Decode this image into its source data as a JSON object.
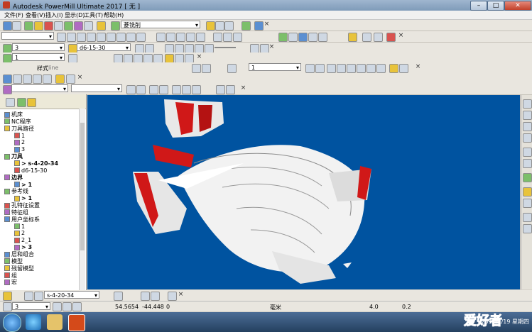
{
  "window": {
    "title": "Autodesk PowerMill Ultimate 2017   [ 无 ]",
    "min": "–",
    "max": "□",
    "close": "✕"
  },
  "menu": [
    "文件(F)",
    "查看(V)",
    "插入(I)",
    "显示(D)",
    "工具(T)",
    "帮助(H)"
  ],
  "toolbars": {
    "row1_combo": "菱铣削",
    "row3_combo_a": "3",
    "row3_combo_b": "d6-15-30",
    "row4_combo": "1",
    "row5_style_label": "样式",
    "row5_style_value": "line",
    "row5_combo_right": "1"
  },
  "explorer": {
    "items": [
      {
        "label": "机床",
        "indent": 0,
        "bold": false
      },
      {
        "label": "NC程序",
        "indent": 0,
        "bold": false
      },
      {
        "label": "刀具路径",
        "indent": 0,
        "bold": false
      },
      {
        "label": "1",
        "indent": 1,
        "bold": false
      },
      {
        "label": "2",
        "indent": 1,
        "bold": false
      },
      {
        "label": "3",
        "indent": 1,
        "bold": false
      },
      {
        "label": "刀具",
        "indent": 0,
        "bold": true
      },
      {
        "label": "> s-4-20-34",
        "indent": 1,
        "bold": true
      },
      {
        "label": "d6-15-30",
        "indent": 1,
        "bold": false
      },
      {
        "label": "边界",
        "indent": 0,
        "bold": true
      },
      {
        "label": "> 1",
        "indent": 1,
        "bold": true
      },
      {
        "label": "参考线",
        "indent": 0,
        "bold": false
      },
      {
        "label": "> 1",
        "indent": 1,
        "bold": true
      },
      {
        "label": "孔特征设置",
        "indent": 0,
        "bold": false
      },
      {
        "label": "特征组",
        "indent": 0,
        "bold": false
      },
      {
        "label": "用户坐标系",
        "indent": 0,
        "bold": false
      },
      {
        "label": "1",
        "indent": 1,
        "bold": false
      },
      {
        "label": "2",
        "indent": 1,
        "bold": false
      },
      {
        "label": "2_1",
        "indent": 1,
        "bold": false
      },
      {
        "label": "> 3",
        "indent": 1,
        "bold": true
      },
      {
        "label": "层和组合",
        "indent": 0,
        "bold": false
      },
      {
        "label": "模型",
        "indent": 0,
        "bold": false
      },
      {
        "label": "残留模型",
        "indent": 0,
        "bold": false
      },
      {
        "label": "组",
        "indent": 0,
        "bold": false
      },
      {
        "label": "宏",
        "indent": 0,
        "bold": false
      }
    ]
  },
  "bottom_toolbar": {
    "tool_combo": "s-4-20-34"
  },
  "status": {
    "workplane": "3",
    "x": "54.5654",
    "y": "-44.448",
    "z": "0",
    "units": "毫米",
    "tolerance": "4.0",
    "thickness": "0.2"
  },
  "taskbar": {
    "clock": "2017/1/19 星期四",
    "watermark": "爱好者"
  },
  "colors": {
    "viewport_bg": "#0053a0",
    "model": "#f2f2f2",
    "red": "#d01818"
  }
}
